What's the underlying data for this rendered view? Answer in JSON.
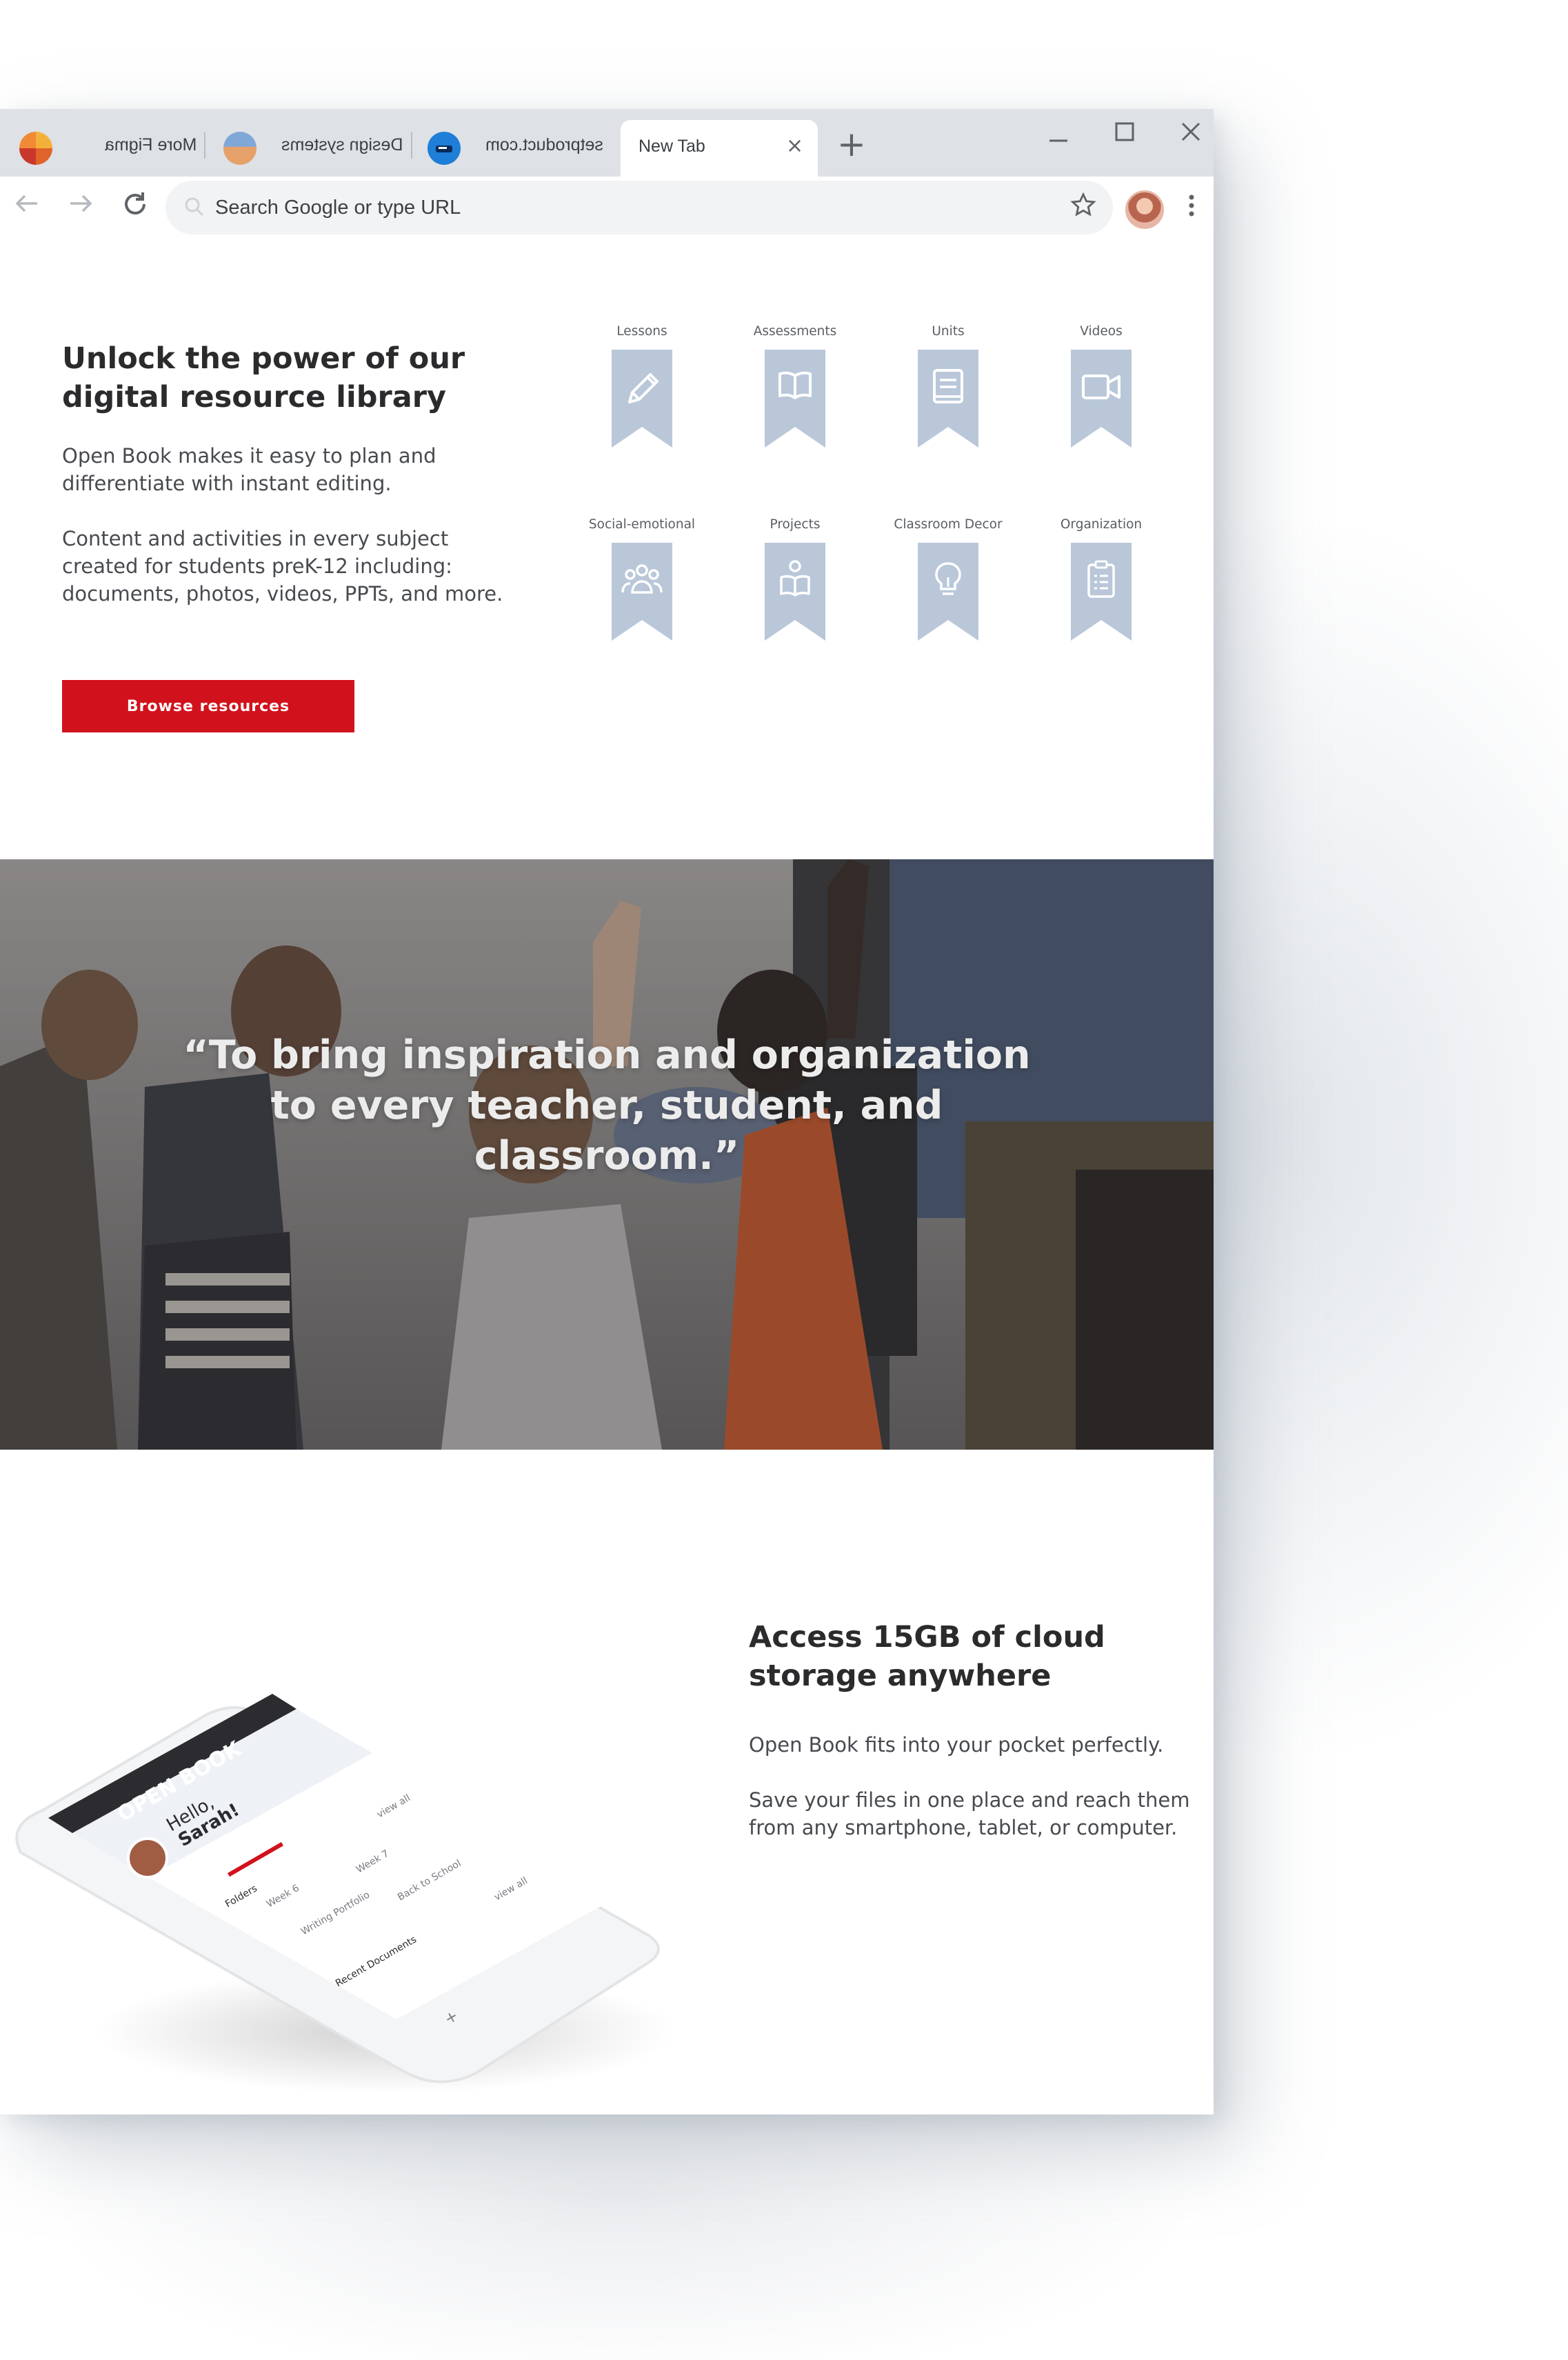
{
  "browser": {
    "tabs": [
      {
        "title": "More Figma",
        "mirrored": true,
        "favicon_color": "#e0632a"
      },
      {
        "title": "Design systems",
        "mirrored": true,
        "favicon_color": "#d98b4a"
      },
      {
        "title": "setproduct.com",
        "mirrored": true,
        "favicon_color": "#1e7ed8"
      },
      {
        "title": "New Tab",
        "mirrored": false,
        "active": true
      }
    ],
    "address_placeholder": "Search Google or type URL"
  },
  "intro": {
    "title_line1": "Unlock the power of our",
    "title_line2": "digital resource library",
    "para1_line1": "Open Book makes it easy to plan and",
    "para1_line2": "differentiate with instant editing.",
    "para2_line1": "Content and activities in every subject",
    "para2_line2": "created for students preK-12 including:",
    "para2_line3": "documents, photos, videos, PPTs, and more.",
    "button_label": "Browse resources"
  },
  "categories": [
    {
      "label": "Lessons",
      "icon": "pencil-icon"
    },
    {
      "label": "Assessments",
      "icon": "open-book-icon"
    },
    {
      "label": "Units",
      "icon": "document-icon"
    },
    {
      "label": "Videos",
      "icon": "video-camera-icon"
    },
    {
      "label": "Social-emotional",
      "icon": "people-group-icon"
    },
    {
      "label": "Projects",
      "icon": "person-reading-icon"
    },
    {
      "label": "Classroom Decor",
      "icon": "lightbulb-icon"
    },
    {
      "label": "Organization",
      "icon": "clipboard-icon"
    }
  ],
  "hero": {
    "quote_line1": "“To bring inspiration and organization",
    "quote_line2": "to every teacher, student, and",
    "quote_line3": "classroom.”"
  },
  "storage": {
    "title_line1": "Access 15GB of cloud",
    "title_line2": "storage anywhere",
    "para1": "Open Book fits into your pocket perfectly.",
    "para2_line1": "Save your files in one place and reach them",
    "para2_line2": "from any smartphone, tablet, or computer."
  },
  "phone_app": {
    "brand": "OPEN BOOK",
    "greeting_line1": "Hello,",
    "greeting_line2": "Sarah!",
    "view_all": "view all",
    "week_7": "Week 7",
    "week_6": "Week 6",
    "back_to_school": "Back to School",
    "writing_portfolio": "Writing Portfolio",
    "folders": "Folders",
    "recent_documents": "Recent Documents",
    "add": "+"
  },
  "colors": {
    "brand_red": "#d1121c",
    "bookmark_blue": "#b9c7d9",
    "icon_blue": "#ffffff"
  }
}
